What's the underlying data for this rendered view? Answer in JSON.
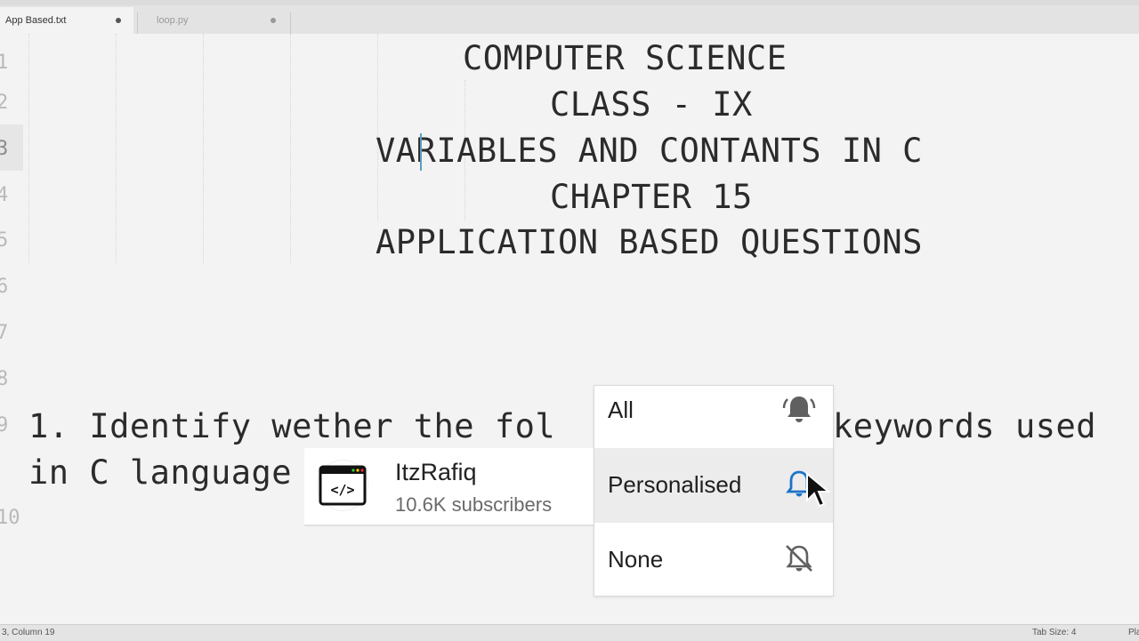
{
  "tabs": [
    {
      "label": "App Based.txt",
      "active": true
    },
    {
      "label": "loop.py",
      "active": false
    }
  ],
  "editor": {
    "line_numbers": [
      "1",
      "2",
      "3",
      "4",
      "5",
      "6",
      "7",
      "8",
      "9",
      "10"
    ],
    "lines": [
      "COMPUTER SCIENCE",
      "CLASS - IX",
      "VARIABLES AND CONTANTS IN C",
      "CHAPTER 15",
      "APPLICATION BASED QUESTIONS",
      "1. Identify wether the fol",
      "keywords used",
      "in C language"
    ]
  },
  "statusbar": {
    "position": "3, Column 19",
    "tab_size": "Tab Size: 4",
    "syntax": "Plain"
  },
  "channel": {
    "name": "ItzRafiq",
    "subscribers": "10.6K subscribers",
    "avatar_glyph": "</>"
  },
  "notification_menu": {
    "options": [
      {
        "label": "All",
        "icon": "bell-ringing-icon"
      },
      {
        "label": "Personalised",
        "icon": "bell-icon",
        "selected": true
      },
      {
        "label": "None",
        "icon": "bell-off-icon"
      }
    ]
  },
  "colors": {
    "accent_blue": "#1a73c8",
    "icon_gray": "#606060",
    "editor_bg": "#f3f3f3"
  }
}
